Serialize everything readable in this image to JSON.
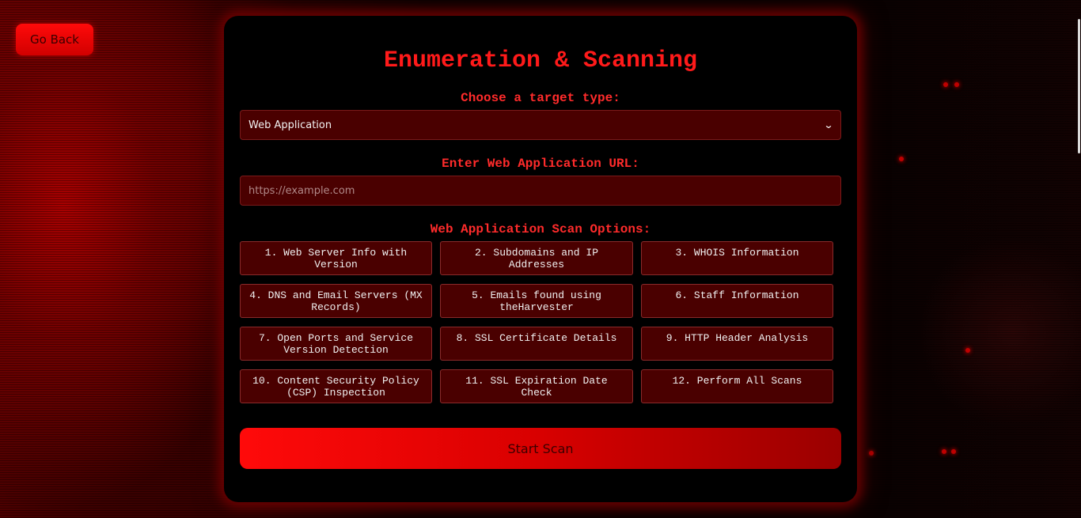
{
  "nav": {
    "back_label": "Go Back"
  },
  "panel": {
    "title": "Enumeration & Scanning",
    "target_type_label": "Choose a target type:",
    "target_type_selected": "Web Application",
    "url_label": "Enter Web Application URL:",
    "url_placeholder": "https://example.com",
    "url_value": "",
    "options_label": "Web Application Scan Options:",
    "options": [
      "1. Web Server Info with Version",
      "2. Subdomains and IP Addresses",
      "3. WHOIS Information",
      "4. DNS and Email Servers (MX Records)",
      "5. Emails found using theHarvester",
      "6. Staff Information",
      "7. Open Ports and Service Version Detection",
      "8. SSL Certificate Details",
      "9. HTTP Header Analysis",
      "10. Content Security Policy (CSP) Inspection",
      "11. SSL Expiration Date Check",
      "12. Perform All Scans"
    ],
    "start_label": "Start Scan"
  },
  "colors": {
    "accent": "#ff1a1a",
    "field_bg": "#4a0000",
    "panel_bg": "#000000"
  }
}
